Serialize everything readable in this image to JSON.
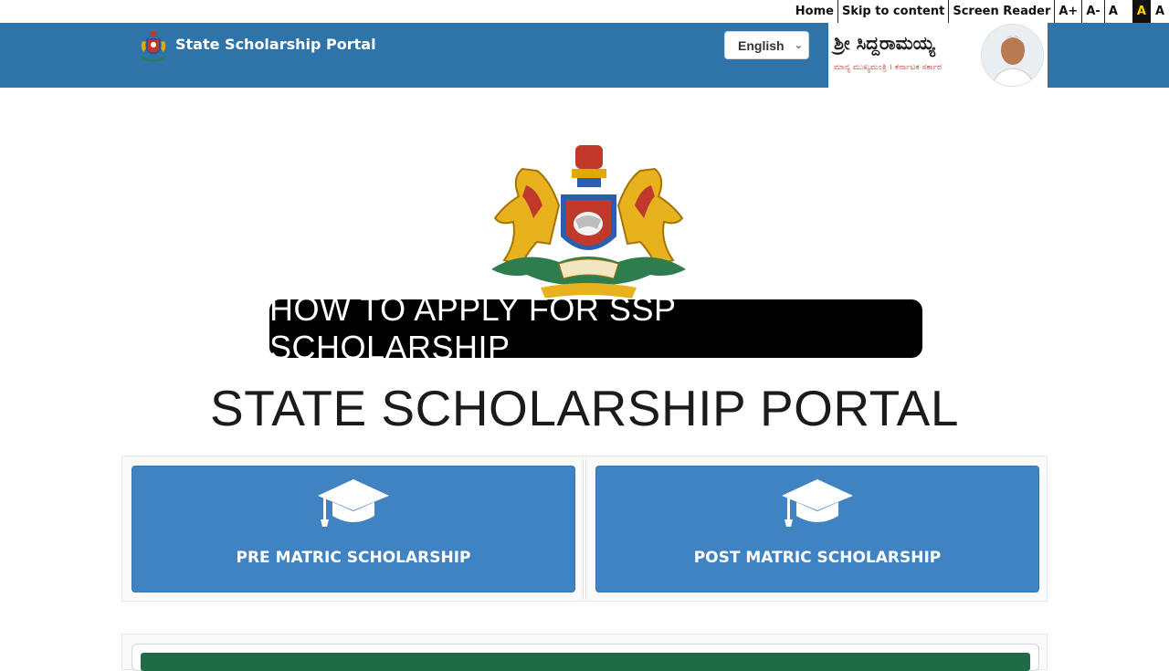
{
  "utility_bar": {
    "home": "Home",
    "skip": "Skip to content",
    "screen_reader": "Screen Reader",
    "font_increase": "A+",
    "font_decrease": "A-",
    "font_reset": "A",
    "contrast_dark": "A",
    "contrast_light": "A"
  },
  "header": {
    "title": "State Scholarship Portal",
    "language": "English",
    "cm_name": "ಶ್ರೀ ಸಿದ್ದರಾಮಯ್ಯ",
    "cm_subtitle": "ಮಾನ್ಯ ಮುಖ್ಯಮಂತ್ರಿ । ಕರ್ನಾಟಕ ಸರ್ಕಾರ",
    "header_color": "#2f74a9"
  },
  "caption": "HOW TO APPLY FOR SSP SCHOLARSHIP",
  "portal_title": "STATE SCHOLARSHIP PORTAL",
  "cards": [
    {
      "label": "PRE MATRIC SCHOLARSHIP",
      "icon": "graduation-cap-icon"
    },
    {
      "label": "POST MATRIC SCHOLARSHIP",
      "icon": "graduation-cap-icon"
    }
  ],
  "colors": {
    "card_blue": "#3f83c3",
    "bottom_green": "#1e6b45"
  }
}
